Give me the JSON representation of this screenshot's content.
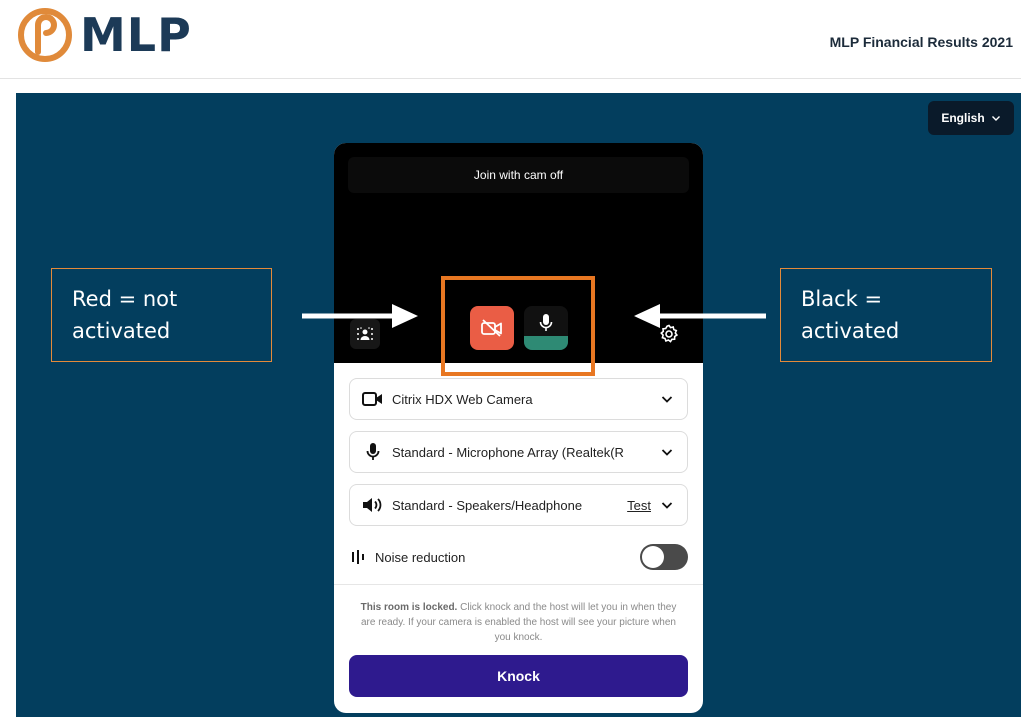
{
  "header": {
    "brand": "MLP",
    "title": "MLP Financial Results 2021"
  },
  "language": {
    "label": "English"
  },
  "preview": {
    "cam_off_banner": "Join with cam off"
  },
  "devices": {
    "camera": "Citrix HDX Web Camera",
    "microphone": "Standard - Microphone Array (Realtek(R",
    "speaker": "Standard - Speakers/Headphone",
    "speaker_test": "Test"
  },
  "noise_reduction": {
    "label": "Noise reduction",
    "enabled": false
  },
  "locked_notice": {
    "bold": "This room is locked.",
    "text": " Click knock and the host will let you in when they are ready. If your camera is enabled the host will see your picture when you knock."
  },
  "knock_button": "Knock",
  "annotations": {
    "left": [
      "Red = not",
      "activated"
    ],
    "right": [
      "Black =",
      "activated"
    ]
  },
  "colors": {
    "brand_navy": "#1c3a57",
    "stage": "#033e5e",
    "cam_off_red": "#ea5d45",
    "mic_level_green": "#2e8a74",
    "knock_purple": "#2e1a8e",
    "callout_orange": "#e87722"
  },
  "icons": {
    "logo": "mlp-logo-icon",
    "camera_off": "camera-off-icon",
    "mic": "microphone-icon",
    "settings": "gear-icon",
    "background": "background-blur-icon",
    "camera": "video-camera-icon",
    "speaker": "speaker-icon",
    "noise": "noise-reduction-icon"
  }
}
